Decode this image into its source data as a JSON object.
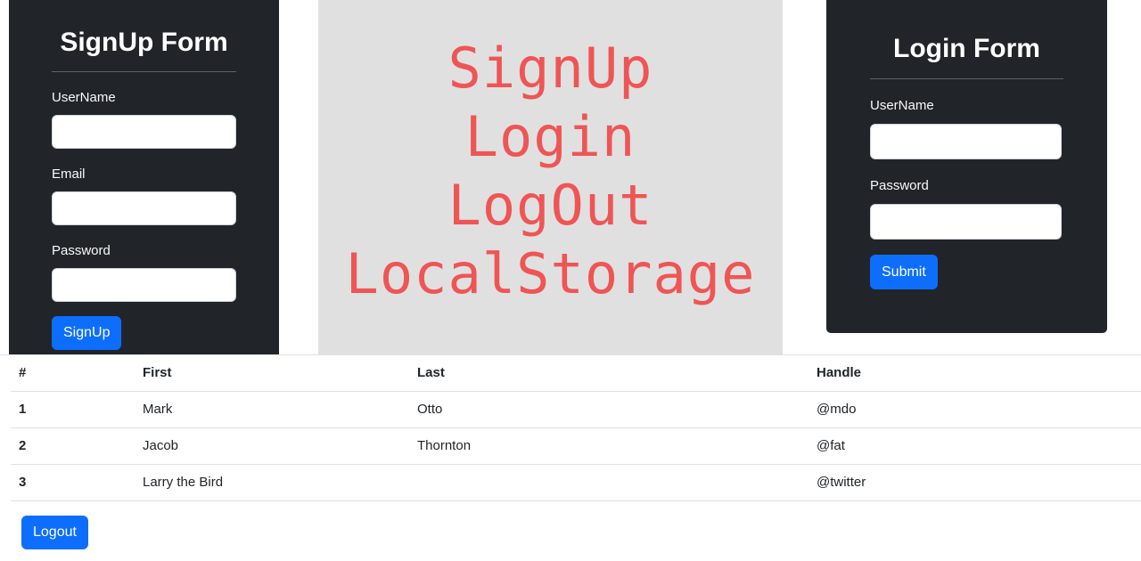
{
  "signup_form": {
    "title": "SignUp Form",
    "fields": [
      {
        "label": "UserName",
        "value": "",
        "placeholder": ""
      },
      {
        "label": "Email",
        "value": "",
        "placeholder": ""
      },
      {
        "label": "Password",
        "value": "",
        "placeholder": ""
      }
    ],
    "submit_label": "SignUp"
  },
  "hero": {
    "lines": [
      "SignUp",
      "Login",
      "LogOut",
      "LocalStorage"
    ],
    "text_color": "#ef5555",
    "background": "#e0e0e0"
  },
  "login_form": {
    "title": "Login Form",
    "fields": [
      {
        "label": "UserName",
        "value": "",
        "placeholder": ""
      },
      {
        "label": "Password",
        "value": "",
        "placeholder": ""
      }
    ],
    "submit_label": "Submit"
  },
  "table": {
    "headers": [
      "#",
      "First",
      "Last",
      "Handle"
    ],
    "rows": [
      [
        "1",
        "Mark",
        "Otto",
        "@mdo"
      ],
      [
        "2",
        "Jacob",
        "Thornton",
        "@fat"
      ],
      [
        "3",
        "Larry the Bird",
        "",
        "@twitter"
      ]
    ]
  },
  "logout_label": "Logout",
  "colors": {
    "card_bg": "#212529",
    "primary": "#0d6efd"
  }
}
